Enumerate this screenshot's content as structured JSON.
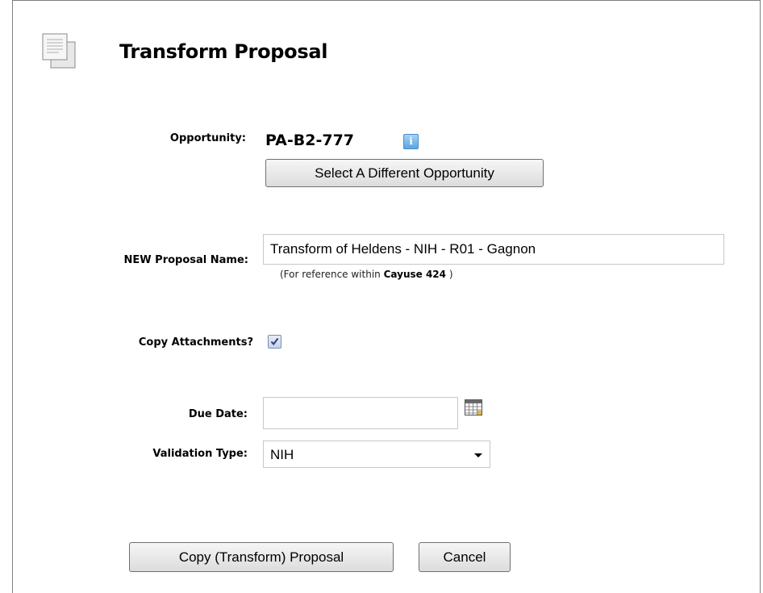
{
  "page": {
    "title": "Transform Proposal",
    "icon": "document-stack-icon"
  },
  "opportunity": {
    "label": "Opportunity:",
    "value": "PA-B2-777",
    "info_icon": "info-icon",
    "select_button": "Select A Different Opportunity"
  },
  "proposal_name": {
    "label": "NEW Proposal Name:",
    "value": "Transform of Heldens - NIH - R01 - Gagnon",
    "hint_prefix": "(For reference within",
    "hint_bold": "Cayuse 424",
    "hint_suffix": ")"
  },
  "copy_attachments": {
    "label": "Copy Attachments?",
    "checked": true
  },
  "due_date": {
    "label": "Due Date:",
    "value": "",
    "calendar_icon": "calendar-icon"
  },
  "validation_type": {
    "label": "Validation Type:",
    "selected": "NIH"
  },
  "actions": {
    "submit": "Copy (Transform) Proposal",
    "cancel": "Cancel"
  }
}
